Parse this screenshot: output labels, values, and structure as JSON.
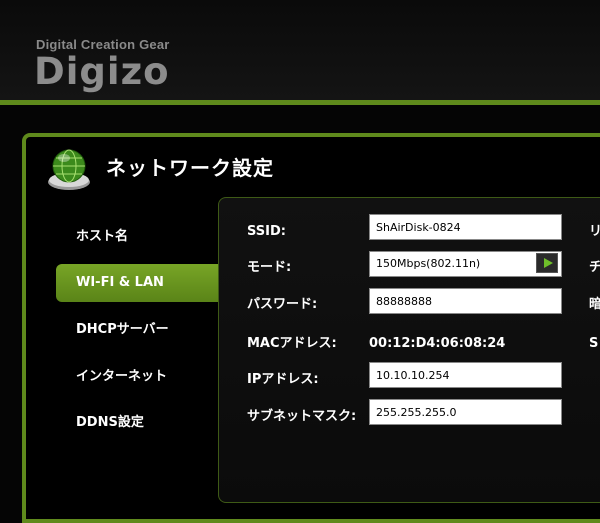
{
  "brand": {
    "tagline": "Digital Creation Gear",
    "logo": "Digizo"
  },
  "page": {
    "title": "ネットワーク設定",
    "icon": "globe-icon"
  },
  "sidebar": {
    "items": [
      {
        "label": "ホスト名",
        "active": false
      },
      {
        "label": "WI-FI & LAN",
        "active": true
      },
      {
        "label": "DHCPサーバー",
        "active": false
      },
      {
        "label": "インターネット",
        "active": false
      },
      {
        "label": "DDNS設定",
        "active": false
      }
    ]
  },
  "form": {
    "ssid": {
      "label": "SSID:",
      "value": "ShAirDisk-0824"
    },
    "mode": {
      "label": "モード:",
      "value": "150Mbps(802.11n)"
    },
    "password": {
      "label": "パスワード:",
      "value": "88888888"
    },
    "mac": {
      "label": "MACアドレス:",
      "value": "00:12:D4:06:08:24"
    },
    "ip": {
      "label": "IPアドレス:",
      "value": "10.10.10.254"
    },
    "subnet": {
      "label": "サブネットマスク:",
      "value": "255.255.255.0"
    }
  },
  "right_column_cut": [
    "リ",
    "チ",
    "暗",
    "S"
  ],
  "colors": {
    "accent": "#5f8a1c",
    "nav_active": "#6b9a22",
    "background": "#050505"
  }
}
